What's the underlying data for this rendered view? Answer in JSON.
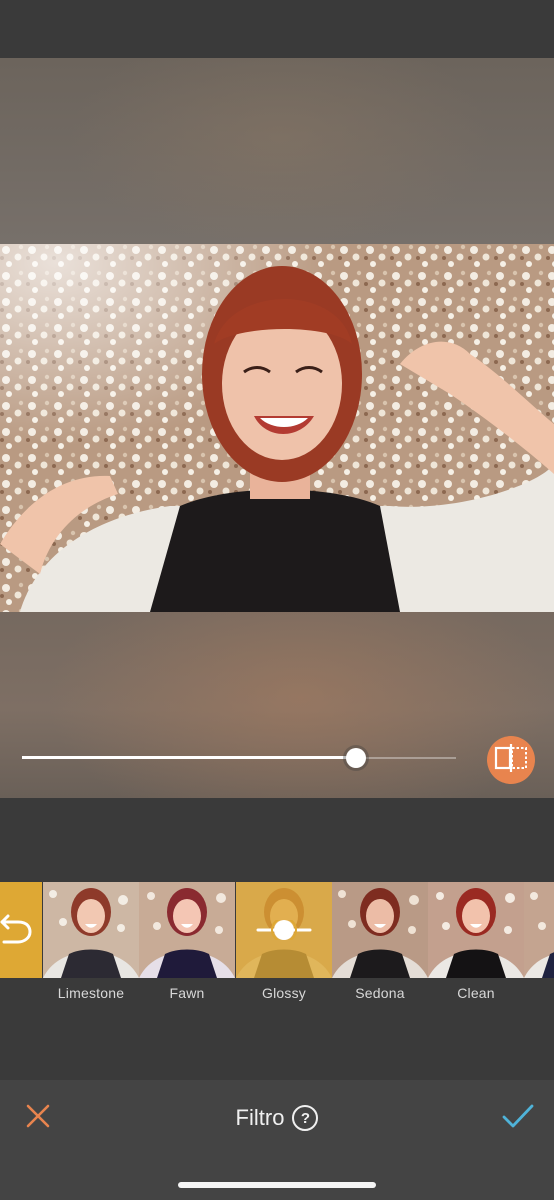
{
  "editor": {
    "intensity_fraction": 0.77
  },
  "filters": [
    {
      "label": "Limestone"
    },
    {
      "label": "Fawn"
    },
    {
      "label": "Glossy"
    },
    {
      "label": "Sedona"
    },
    {
      "label": "Clean"
    }
  ],
  "selected_filter": "Glossy",
  "toolbar": {
    "title": "Filtro",
    "help_symbol": "?"
  },
  "icons": {
    "cancel": "close-icon",
    "confirm": "checkmark-icon",
    "compare": "compare-split-icon",
    "help": "help-circle-icon",
    "undo": "undo-arrow-icon"
  },
  "colors": {
    "accent": "#e8844e",
    "confirm": "#4fb3d9",
    "selected_overlay": "#dea834",
    "bar_background": "#444444"
  }
}
